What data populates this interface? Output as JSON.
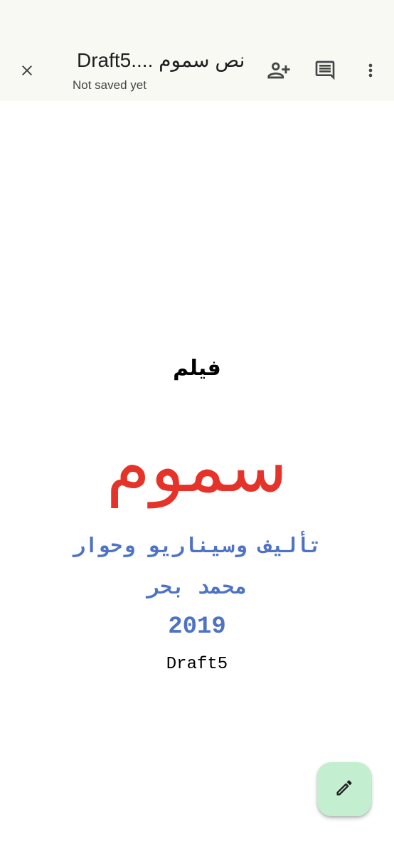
{
  "header": {
    "title": "نص سموم ....Draft5",
    "subtitle": "Not saved yet",
    "icons": {
      "close": "close-icon",
      "share": "person-add-icon",
      "comments": "comment-icon",
      "more": "more-vert-icon"
    }
  },
  "document": {
    "film_label": "فيلم",
    "title": "سموم",
    "credits": "تأليف وسيناريو وحوار",
    "author": "محمد بحر",
    "year": "2019",
    "draft": "Draft5"
  },
  "fab": {
    "icon": "edit-pencil-icon"
  },
  "colors": {
    "app_bar_bg": "#f8f9f3",
    "title_red": "#e5332a",
    "credits_blue": "#4f73c4",
    "fab_bg": "#c4eed0"
  }
}
